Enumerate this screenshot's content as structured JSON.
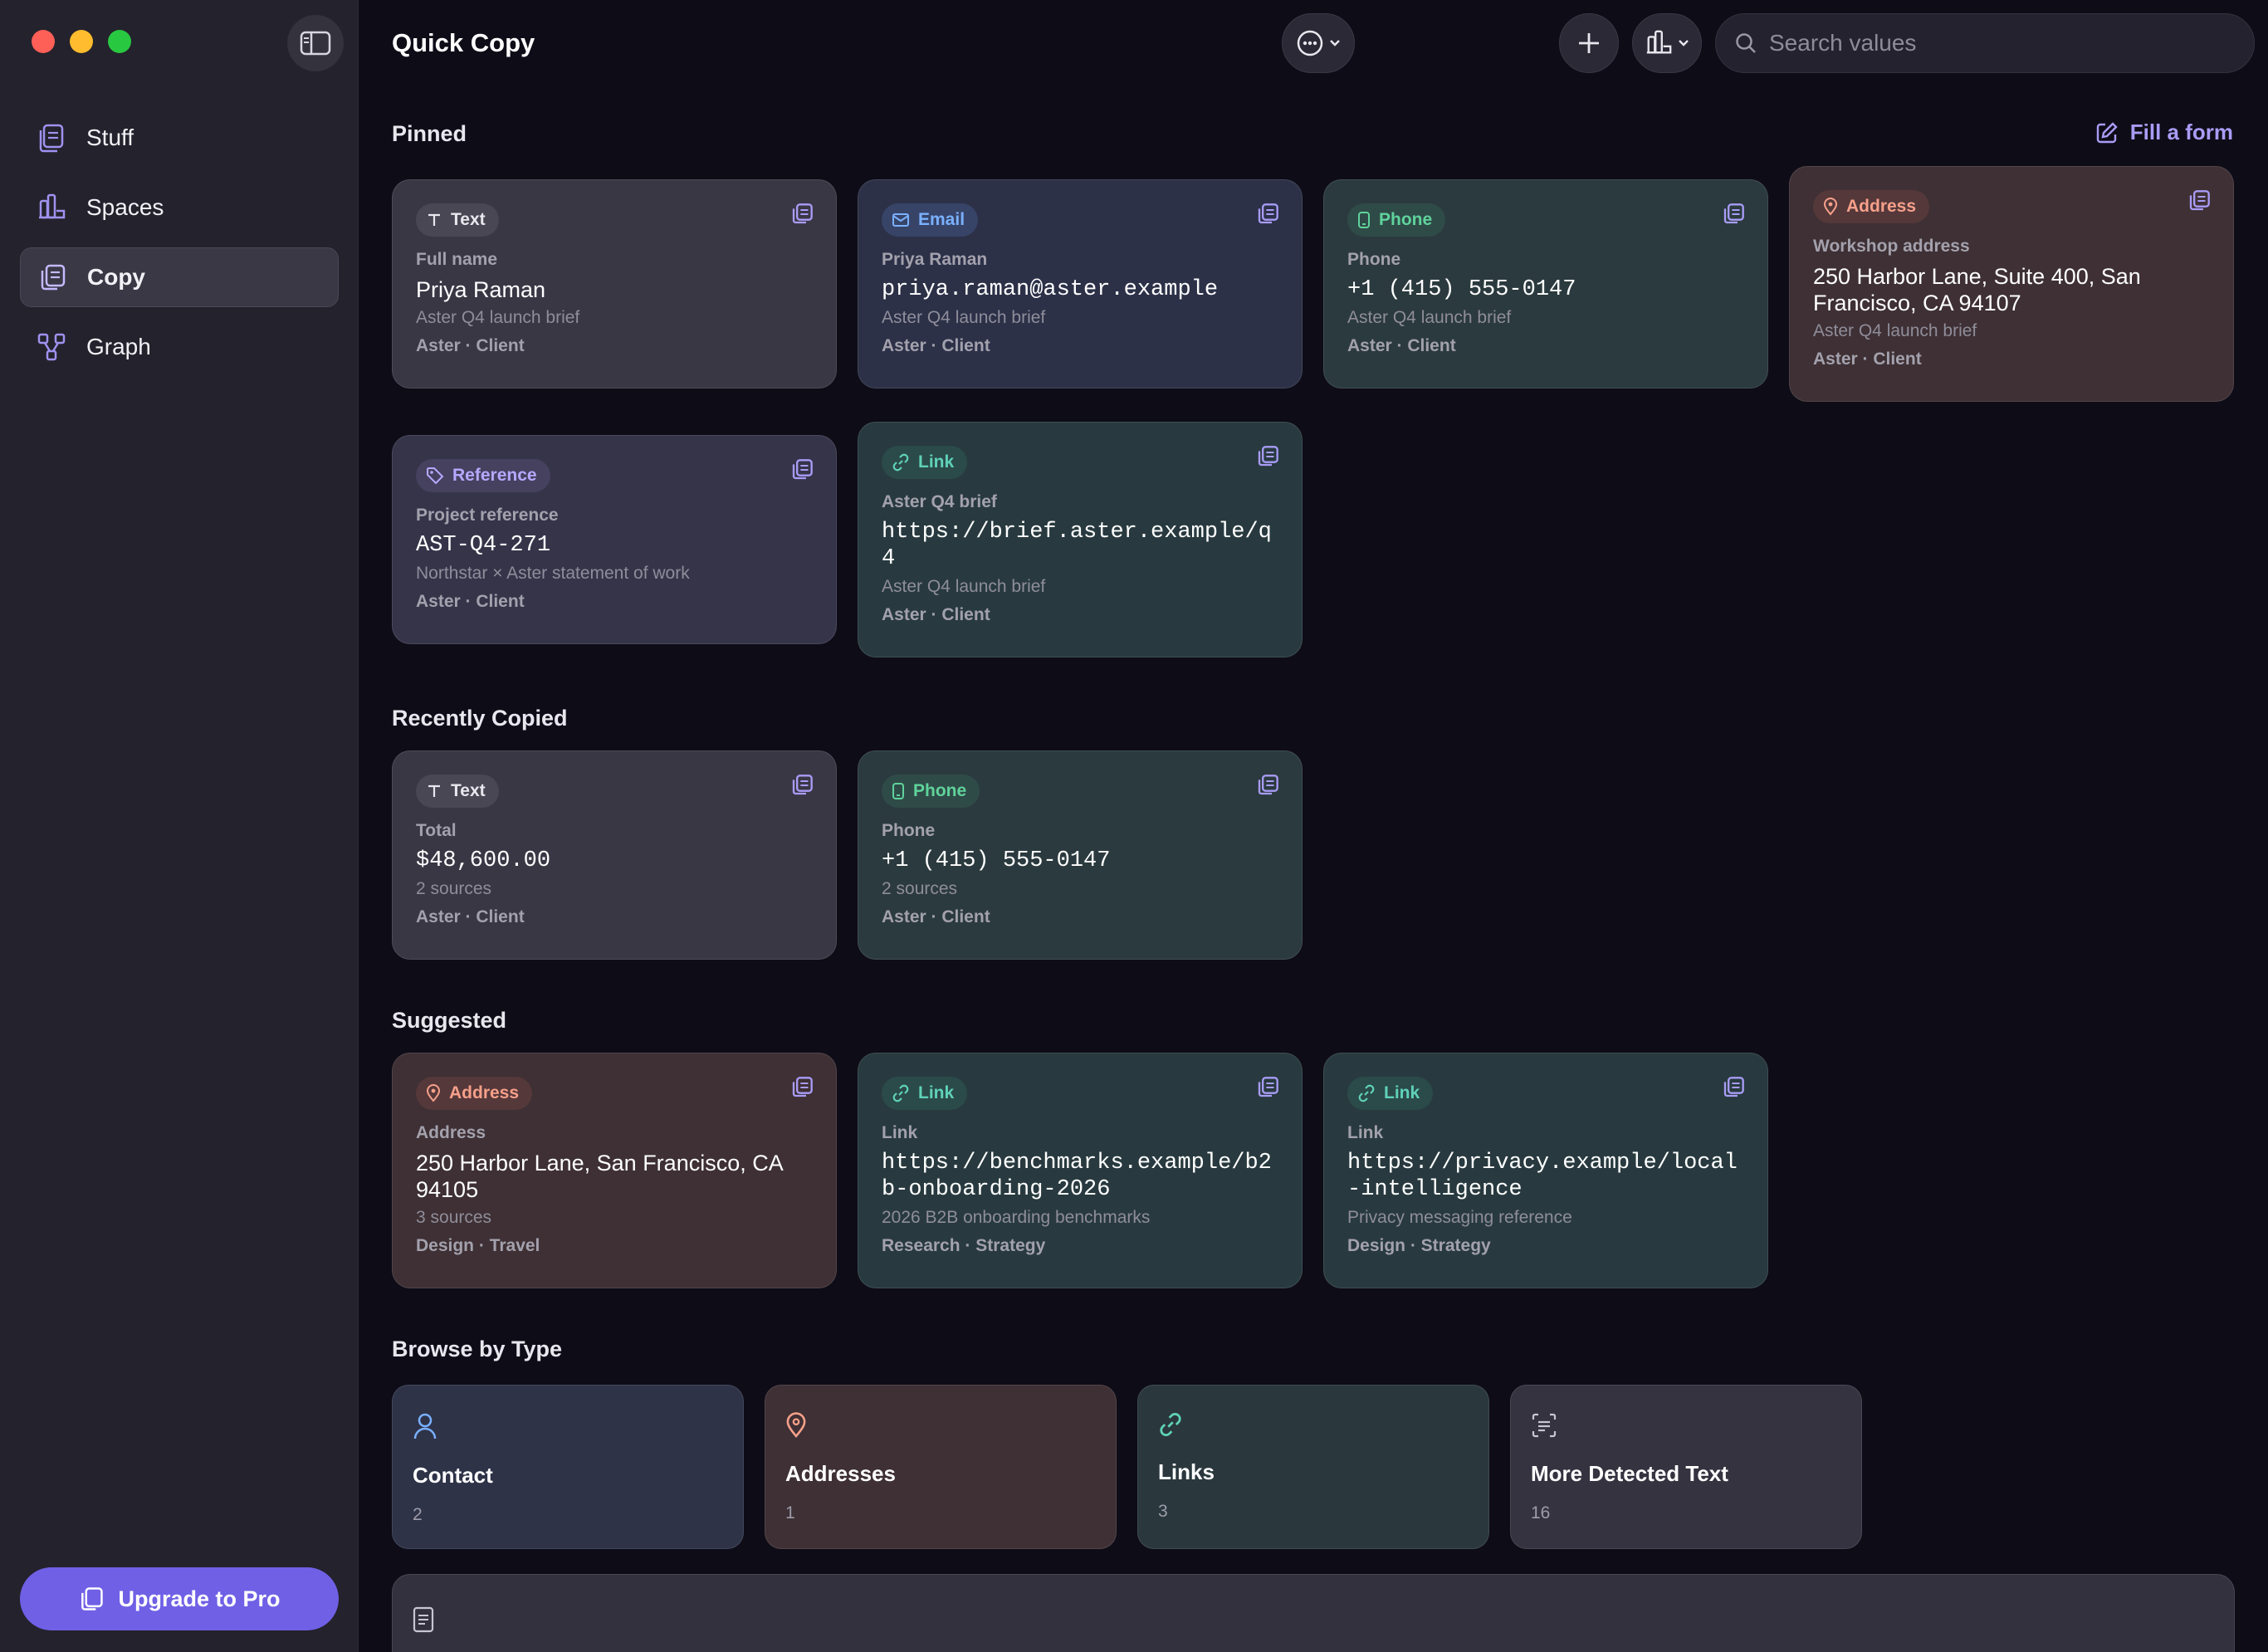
{
  "sidebar": {
    "items": [
      {
        "label": "Stuff"
      },
      {
        "label": "Spaces"
      },
      {
        "label": "Copy"
      },
      {
        "label": "Graph"
      }
    ],
    "upgrade_label": "Upgrade to Pro"
  },
  "header": {
    "title": "Quick Copy",
    "search_placeholder": "Search values"
  },
  "sections": {
    "pinned": "Pinned",
    "recent": "Recently Copied",
    "suggested": "Suggested",
    "browse": "Browse by Type",
    "fill_form": "Fill a form"
  },
  "pinned": [
    {
      "badge": "Text",
      "label": "Full name",
      "value": "Priya Raman",
      "sub": "Aster Q4 launch brief",
      "meta": "Aster · Client"
    },
    {
      "badge": "Email",
      "label": "Priya Raman",
      "value": "priya.raman@aster.example",
      "sub": "Aster Q4 launch brief",
      "meta": "Aster · Client"
    },
    {
      "badge": "Phone",
      "label": "Phone",
      "value": "+1 (415) 555-0147",
      "sub": "Aster Q4 launch brief",
      "meta": "Aster · Client"
    },
    {
      "badge": "Address",
      "label": "Workshop address",
      "value": "250 Harbor Lane, Suite 400, San Francisco, CA 94107",
      "sub": "Aster Q4 launch brief",
      "meta": "Aster · Client"
    },
    {
      "badge": "Reference",
      "label": "Project reference",
      "value": "AST-Q4-271",
      "sub": "Northstar × Aster statement of work",
      "meta": "Aster · Client"
    },
    {
      "badge": "Link",
      "label": "Aster Q4 brief",
      "value": "https://brief.aster.example/q4",
      "sub": "Aster Q4 launch brief",
      "meta": "Aster · Client"
    }
  ],
  "recent": [
    {
      "badge": "Text",
      "label": "Total",
      "value": "$48,600.00",
      "sub": "2 sources",
      "meta": "Aster · Client"
    },
    {
      "badge": "Phone",
      "label": "Phone",
      "value": "+1 (415) 555-0147",
      "sub": "2 sources",
      "meta": "Aster · Client"
    }
  ],
  "suggested": [
    {
      "badge": "Address",
      "label": "Address",
      "value": "250 Harbor Lane, San Francisco, CA 94105",
      "sub": "3 sources",
      "meta": "Design · Travel"
    },
    {
      "badge": "Link",
      "label": "Link",
      "value": "https://benchmarks.example/b2b-onboarding-2026",
      "sub": "2026 B2B onboarding benchmarks",
      "meta": "Research · Strategy"
    },
    {
      "badge": "Link",
      "label": "Link",
      "value": "https://privacy.example/local-intelligence",
      "sub": "Privacy messaging reference",
      "meta": "Design · Strategy"
    }
  ],
  "types": [
    {
      "name": "Contact",
      "count": "2"
    },
    {
      "name": "Addresses",
      "count": "1"
    },
    {
      "name": "Links",
      "count": "3"
    },
    {
      "name": "More Detected Text",
      "count": "16"
    }
  ],
  "colors": {
    "accent": "#6f60e6",
    "email": "#7ab0ff",
    "phone": "#5fd39b",
    "address": "#f6a08a",
    "link": "#5fd2b8",
    "reference": "#b7a8ff"
  }
}
